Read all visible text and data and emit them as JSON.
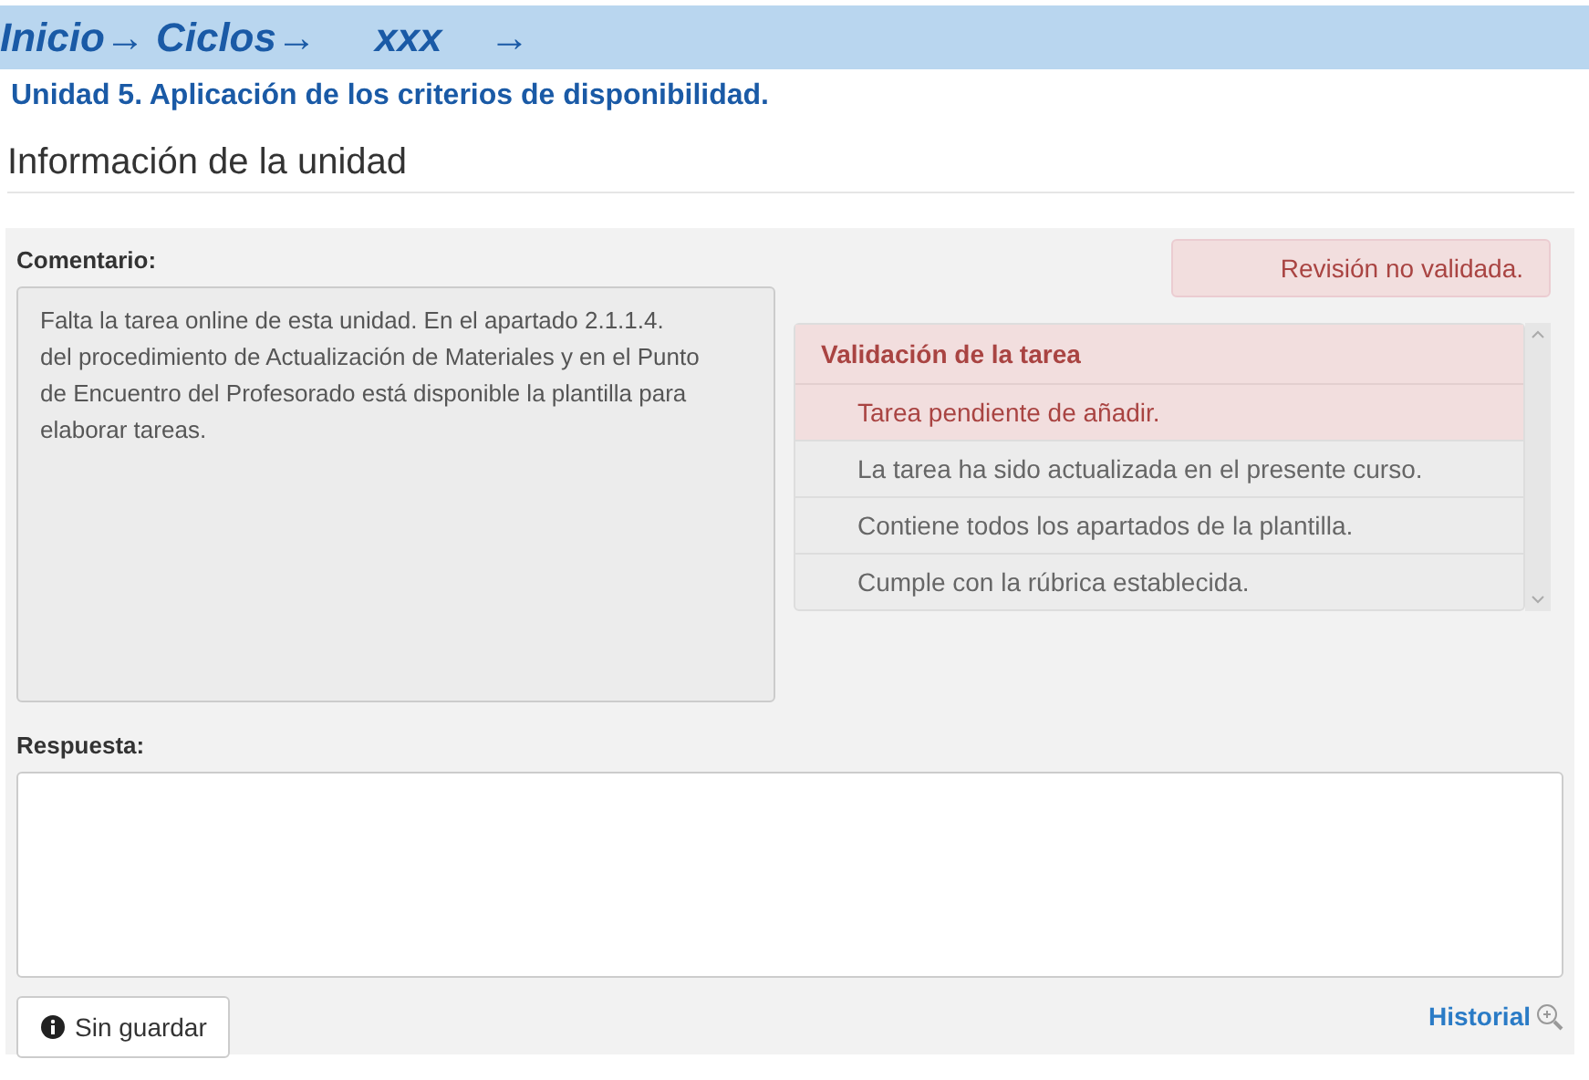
{
  "breadcrumb": [
    "Inicio→",
    "Ciclos→",
    "xxx",
    "→"
  ],
  "unit_title": "Unidad 5. Aplicación de los criterios de disponibilidad.",
  "section_heading": "Información de la unidad",
  "comment": {
    "label": "Comentario:",
    "text": "Falta la tarea online de esta unidad. En el apartado 2.1.1.4. del procedimiento de Actualización de Materiales y en el Punto de Encuentro del Profesorado está disponible la plantilla para elaborar tareas."
  },
  "review_status": "Revisión no validada.",
  "validation": {
    "title": "Validación de la tarea",
    "items": [
      {
        "text": "Tarea pendiente de añadir.",
        "failed": true
      },
      {
        "text": "La tarea ha sido actualizada en el presente curso.",
        "failed": false
      },
      {
        "text": "Contiene todos los apartados de la plantilla.",
        "failed": false
      },
      {
        "text": "Cumple con la rúbrica establecida.",
        "failed": false
      }
    ]
  },
  "response": {
    "label": "Respuesta:"
  },
  "save_button": "Sin guardar",
  "history_link": "Historial"
}
